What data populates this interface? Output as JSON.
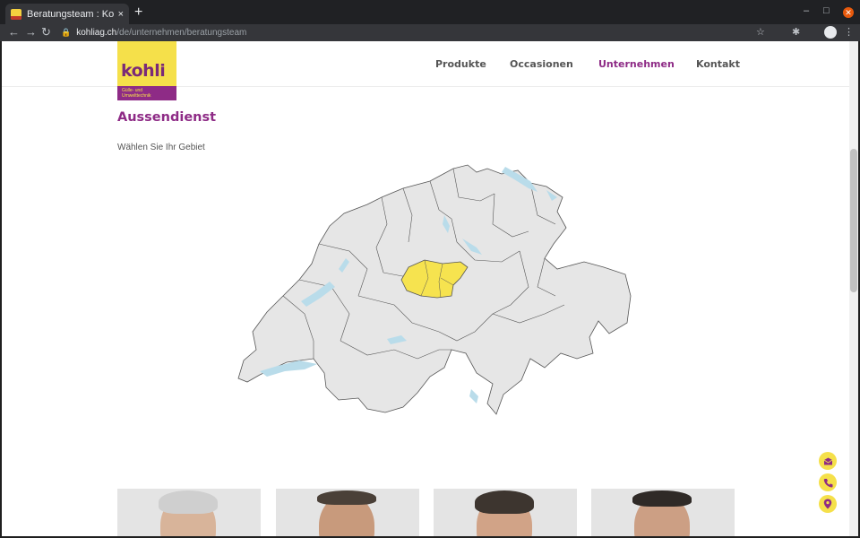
{
  "browser": {
    "tab_title": "Beratungsteam : Kohli AG",
    "tab_close": "×",
    "new_tab": "+",
    "url_host": "kohliag.ch",
    "url_path": "/de/unternehmen/beratungsteam",
    "back": "←",
    "forward": "→",
    "reload": "↻",
    "lock": "🔒",
    "bookmark": "☆",
    "menu": "⋮",
    "extensions": "✱",
    "minimize": "–",
    "maximize": "□",
    "close": "✕"
  },
  "site": {
    "logo_word": "kohli",
    "logo_tagline_line1": "Gülle- und",
    "logo_tagline_line2": "Umwelttechnik",
    "nav": [
      {
        "label": "Produkte",
        "active": false
      },
      {
        "label": "Occasionen",
        "active": false
      },
      {
        "label": "Unternehmen",
        "active": true
      },
      {
        "label": "Kontakt",
        "active": false
      }
    ],
    "accent_color": "#8e2b86",
    "brand_yellow": "#f5e04a"
  },
  "content": {
    "title": "Aussendienst",
    "subtitle": "Wählen Sie Ihr Gebiet",
    "map": {
      "land_color": "#e6e6e6",
      "border_color": "#555555",
      "lake_color": "#b9dcea",
      "highlight_color": "#f6e34f",
      "highlighted_region": "central-switzerland"
    },
    "team_cards": 4
  },
  "floating_actions": [
    "mail-icon",
    "phone-icon",
    "location-pin-icon"
  ]
}
